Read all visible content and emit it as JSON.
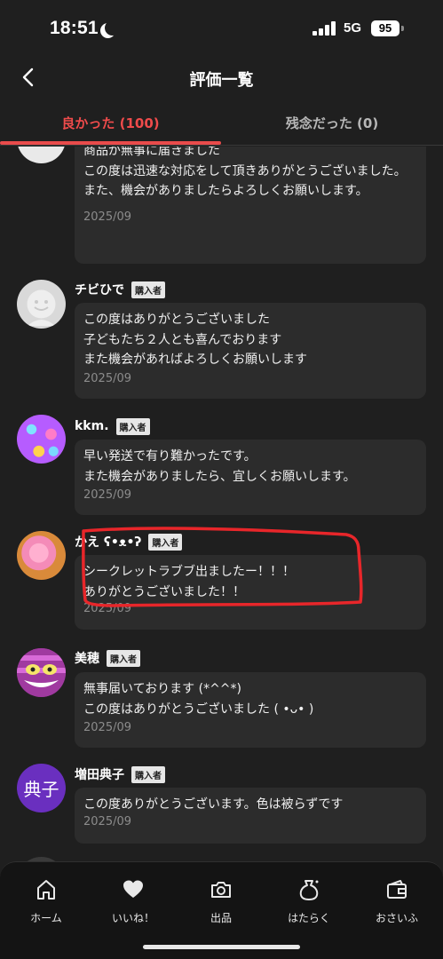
{
  "status_bar": {
    "time": "18:51",
    "network": "5G",
    "battery": "95"
  },
  "header": {
    "title": "評価一覧"
  },
  "tabs": [
    {
      "label": "良かった (100)",
      "active": true
    },
    {
      "label": "残念だった (0)",
      "active": false
    }
  ],
  "reviews": [
    {
      "name": "",
      "badge": "",
      "text": "商品が無事に届きました\nこの度は迅速な対応をして頂きありがとうございました。\nまた、機会がありましたらよろしくお願いします。",
      "date": "2025/09"
    },
    {
      "name": "チビひで",
      "badge": "購入者",
      "text": "この度はありがとうございました\n子どもたち２人とも喜んでおります\nまた機会があればよろしくお願いします",
      "date": "2025/09"
    },
    {
      "name": "kkm.",
      "badge": "購入者",
      "text": "早い発送で有り難かったです。\nまた機会がありましたら、宜しくお願いします。",
      "date": "2025/09"
    },
    {
      "name": "かえ ʕ•ᴥ•ʔ",
      "badge": "購入者",
      "text": "シークレットラブブ出ましたー！！！\nありがとうございました！！",
      "date": "2025/09"
    },
    {
      "name": "美穂",
      "badge": "購入者",
      "text": "無事届いております (*^^*)\nこの度はありがとうございました ( •ᴗ• )",
      "date": "2025/09"
    },
    {
      "name": "増田典子",
      "badge": "購入者",
      "avatar_text": "典子",
      "text": "この度ありがとうございます。色は被らずです",
      "date": "2025/09"
    }
  ],
  "bottom_nav": [
    {
      "label": "ホーム",
      "icon": "home-icon"
    },
    {
      "label": "いいね！",
      "icon": "heart-icon"
    },
    {
      "label": "出品",
      "icon": "camera-icon"
    },
    {
      "label": "はたらく",
      "icon": "money-bag-icon"
    },
    {
      "label": "おさいふ",
      "icon": "wallet-icon"
    }
  ],
  "colors": {
    "accent": "#e94b4b",
    "background": "#1f1f1f",
    "bubble": "#2c2c2c",
    "highlight": "#e8262a"
  }
}
